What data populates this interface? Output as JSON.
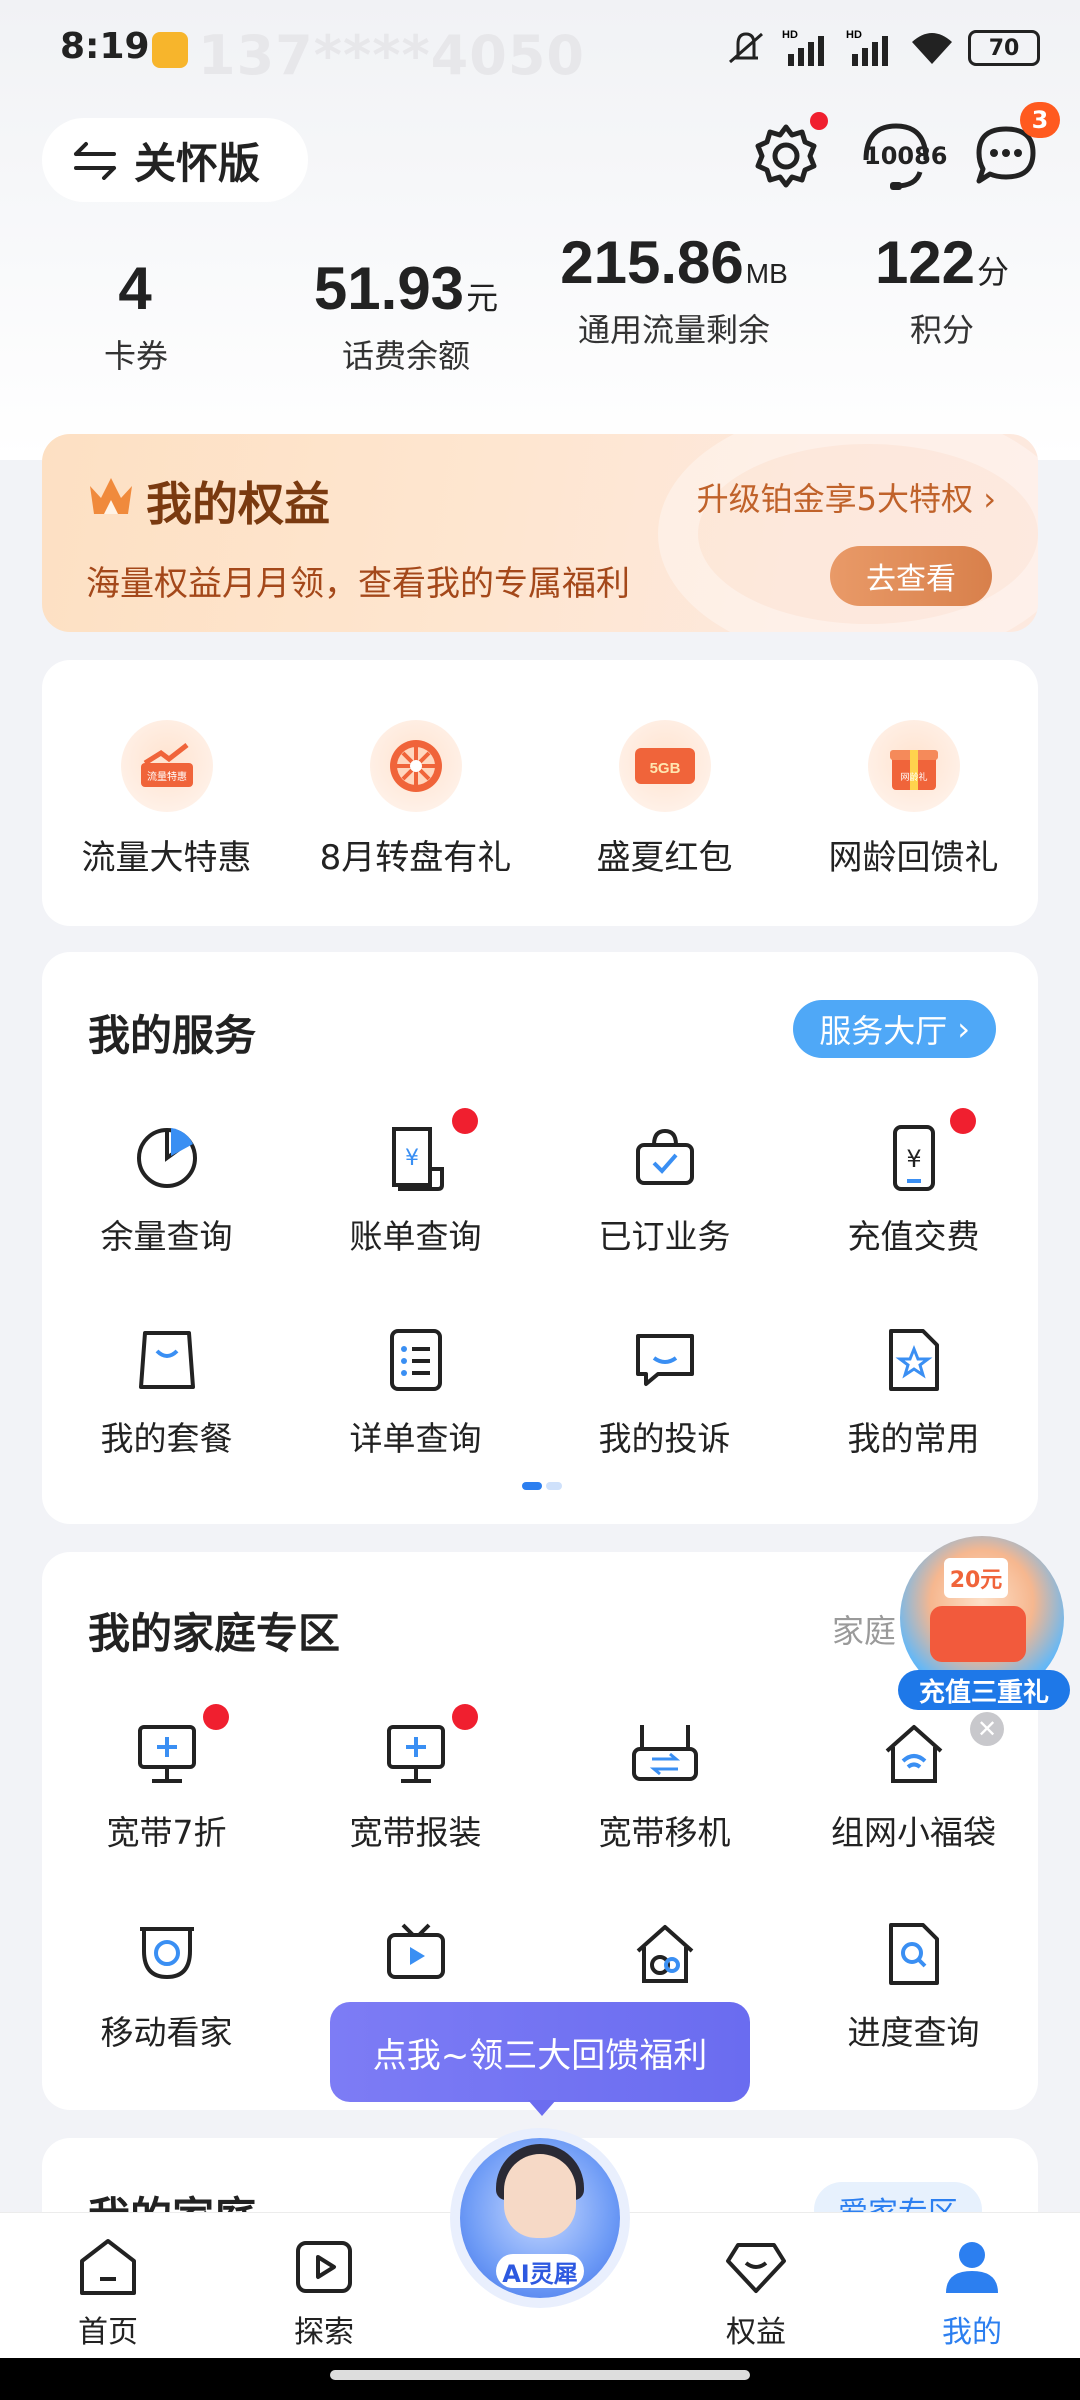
{
  "status_bar": {
    "time": "8:19",
    "phone_masked": "137****4050",
    "battery": "70",
    "icons": [
      "mute-icon",
      "hd-signal-icon",
      "hd-signal-icon",
      "wifi-icon",
      "battery-icon"
    ]
  },
  "header": {
    "care_mode_label": "关怀版",
    "hotline_label": "10086",
    "message_badge": "3",
    "icons": [
      "switch-arrows-icon",
      "settings-gear-icon",
      "customer-service-headset-icon",
      "message-bubble-icon"
    ]
  },
  "stats": [
    {
      "value": "4",
      "unit": "",
      "label": "卡券"
    },
    {
      "value": "51.93",
      "unit": "元",
      "label": "话费余额"
    },
    {
      "value": "215.86",
      "unit": "MB",
      "label": "通用流量剩余"
    },
    {
      "value": "122",
      "unit": "分",
      "label": "积分"
    }
  ],
  "rights_banner": {
    "title": "我的权益",
    "upgrade_link": "升级铂金享5大特权",
    "subtitle": "海量权益月月领，查看我的专属福利",
    "button": "去查看"
  },
  "promos": [
    {
      "label": "流量大特惠",
      "icon": "traffic-deal-icon",
      "icon_text": "流量特惠"
    },
    {
      "label": "8月转盘有礼",
      "icon": "wheel-icon"
    },
    {
      "label": "盛夏红包",
      "icon": "red-packet-icon",
      "icon_text": "5GB"
    },
    {
      "label": "网龄回馈礼",
      "icon": "gift-box-icon",
      "icon_text": "网龄礼"
    }
  ],
  "services": {
    "title": "我的服务",
    "hall_button": "服务大厅",
    "items": [
      {
        "label": "余量查询",
        "icon": "pie-chart-icon",
        "dot": false
      },
      {
        "label": "账单查询",
        "icon": "bill-icon",
        "dot": true
      },
      {
        "label": "已订业务",
        "icon": "bag-check-icon",
        "dot": false
      },
      {
        "label": "充值交费",
        "icon": "phone-yuan-icon",
        "dot": true
      },
      {
        "label": "我的套餐",
        "icon": "shopping-bag-icon",
        "dot": false
      },
      {
        "label": "详单查询",
        "icon": "list-doc-icon",
        "dot": false
      },
      {
        "label": "我的投诉",
        "icon": "chat-box-icon",
        "dot": false
      },
      {
        "label": "我的常用",
        "icon": "star-doc-icon",
        "dot": false
      }
    ]
  },
  "family_zone": {
    "title": "我的家庭专区",
    "link": "家庭",
    "items": [
      {
        "label": "宽带7折",
        "icon": "monitor-plus-icon",
        "dot": true
      },
      {
        "label": "宽带报装",
        "icon": "monitor-plus-icon",
        "dot": true
      },
      {
        "label": "宽带移机",
        "icon": "router-transfer-icon",
        "dot": false
      },
      {
        "label": "组网小福袋",
        "icon": "home-wifi-icon",
        "dot": false
      },
      {
        "label": "移动看家",
        "icon": "camera-icon",
        "dot": false
      },
      {
        "label": "",
        "icon": "tv-play-icon",
        "dot": false
      },
      {
        "label": "",
        "icon": "home-camera-icon",
        "dot": false
      },
      {
        "label": "进度查询",
        "icon": "search-doc-icon",
        "dot": false
      }
    ]
  },
  "floating_promo": {
    "tag": "充值三重礼",
    "badge_text": "20元"
  },
  "tooltip": "点我~领三大回馈福利",
  "family_card": {
    "title": "我的家庭",
    "button": "爱家专区"
  },
  "ai_assistant": {
    "label": "AI灵犀"
  },
  "bottom_nav": [
    {
      "label": "首页",
      "icon": "home-icon",
      "active": false
    },
    {
      "label": "探索",
      "icon": "play-icon",
      "active": false
    },
    {
      "label": "权益",
      "icon": "diamond-icon",
      "active": false
    },
    {
      "label": "我的",
      "icon": "user-icon",
      "active": true
    }
  ],
  "colors": {
    "accent": "#2C7FF0",
    "badge_red": "#F01F2F",
    "rights_text": "#A4481A"
  }
}
